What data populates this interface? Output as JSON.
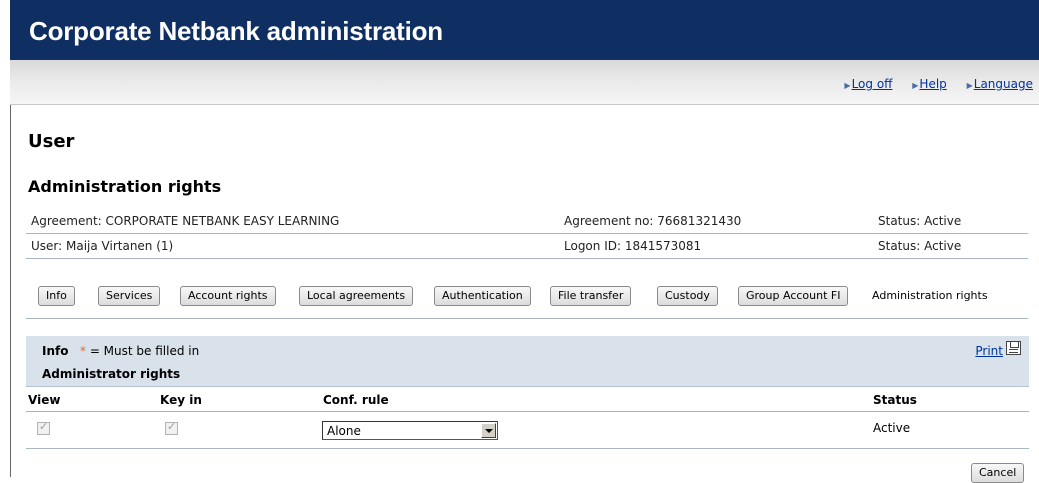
{
  "header": {
    "title": "Corporate Netbank administration"
  },
  "top_links": [
    {
      "label": "Log off"
    },
    {
      "label": "Help"
    },
    {
      "label": "Language"
    }
  ],
  "page": {
    "title": "User",
    "section_title": "Administration rights"
  },
  "agreement": {
    "name": "Agreement: CORPORATE NETBANK EASY LEARNING",
    "number": "Agreement no: 76681321430",
    "status": "Status: Active"
  },
  "user": {
    "name": "User: Maija Virtanen (1)",
    "logon_id": "Logon ID: 1841573081",
    "status": "Status: Active"
  },
  "tabs": [
    {
      "label": "Info"
    },
    {
      "label": "Services"
    },
    {
      "label": "Account rights"
    },
    {
      "label": "Local agreements"
    },
    {
      "label": "Authentication"
    },
    {
      "label": "File transfer"
    },
    {
      "label": "Custody"
    },
    {
      "label": "Group Account FI"
    }
  ],
  "current_tab": "Administration rights",
  "panel": {
    "info_label": "Info",
    "required_star": "*",
    "required_text": " = Must be filled in",
    "section_label": "Administrator rights",
    "print_label": "Print"
  },
  "table": {
    "headers": {
      "view": "View",
      "key_in": "Key in",
      "conf_rule": "Conf. rule",
      "status": "Status"
    },
    "rows": [
      {
        "view_checked": true,
        "key_in_checked": true,
        "conf_rule": "Alone",
        "status": "Active"
      }
    ]
  },
  "actions": {
    "cancel": "Cancel"
  },
  "colors": {
    "header_bg": "#0f2f63",
    "panel_bg": "#d9e1ea",
    "link": "#003399",
    "required_star": "#e36a2d"
  },
  "icons": [
    "arrow-right-icon",
    "printer-icon",
    "chevron-down-icon",
    "checkmark-icon"
  ]
}
